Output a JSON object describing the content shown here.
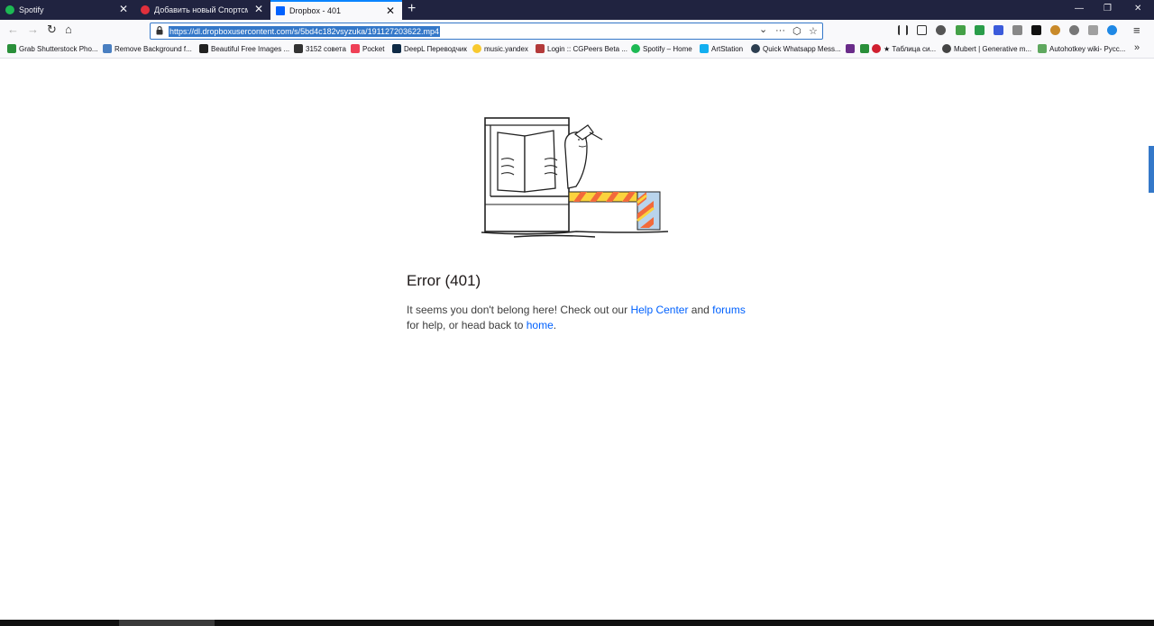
{
  "tabs": [
    {
      "title": "Spotify",
      "active": false,
      "favicon_color": "#1db954",
      "favicon": "spotify-icon"
    },
    {
      "title": "Добавить новый Спортсмен",
      "active": false,
      "favicon_color": "#e0303c",
      "favicon": "site-icon"
    },
    {
      "title": "Dropbox - 401",
      "active": true,
      "favicon_color": "#0061fe",
      "favicon": "dropbox-icon"
    }
  ],
  "tab_close": "✕",
  "newtab_label": "+",
  "window_controls": {
    "minimize": "—",
    "restore": "❐",
    "close": "✕"
  },
  "nav": {
    "back": "←",
    "forward": "→",
    "reload": "↻",
    "home": "⌂"
  },
  "url": "https://dl.dropboxusercontent.com/s/5bd4c182vsyzuka/191127203622.mp4",
  "url_icons": {
    "dropdown": "⌄",
    "more": "···",
    "pocket": "⬡",
    "star": "☆"
  },
  "menu_icon": "≡",
  "bookmarks": [
    {
      "label": "Grab Shutterstock Pho...",
      "color": "#2a8f3a"
    },
    {
      "label": "Remove Background f...",
      "color": "#4a7fc1"
    },
    {
      "label": "Beautiful Free Images ...",
      "color": "#222222"
    },
    {
      "label": "3152 совета",
      "color": "#333333"
    },
    {
      "label": "Pocket",
      "color": "#ef4056"
    },
    {
      "label": "DeepL Переводчик",
      "color": "#0f2b46"
    },
    {
      "label": "music.yandex",
      "color": "#f8c92f"
    },
    {
      "label": "Login :: CGPeers Beta ...",
      "color": "#b33a3a"
    },
    {
      "label": "Spotify – Home",
      "color": "#1db954"
    },
    {
      "label": "ArtStation",
      "color": "#13aff0"
    },
    {
      "label": "Quick Whatsapp Mess...",
      "color": "#2c3e50"
    },
    {
      "label": "",
      "color": "#6a2c8a"
    },
    {
      "label": "",
      "color": "#2a8f3a"
    },
    {
      "label": "★ Таблица си...",
      "color": "#d01f2f"
    },
    {
      "label": "Mubert | Generative m...",
      "color": "#444444"
    },
    {
      "label": "Autohotkey wiki- Русс...",
      "color": "#5fa85f"
    }
  ],
  "bookmarks_more": "»",
  "error": {
    "title": "Error (401)",
    "text_before": "It seems you don't belong here! Check out our ",
    "link_help": "Help Center",
    "text_and": " and ",
    "link_forums": "forums",
    "text_mid": " for help, or head back to ",
    "link_home": "home",
    "text_end": "."
  }
}
